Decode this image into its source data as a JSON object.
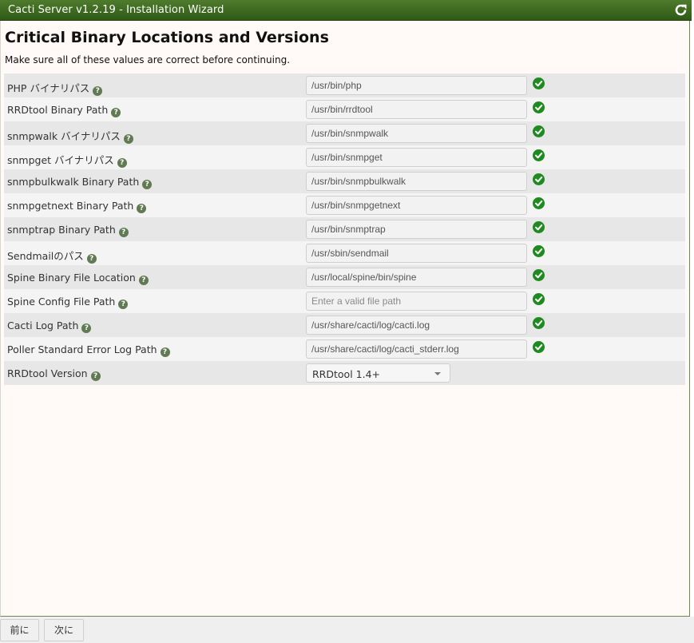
{
  "window": {
    "title": "Cacti Server v1.2.19 - Installation Wizard"
  },
  "header": {
    "title": "Critical Binary Locations and Versions",
    "subtitle": "Make sure all of these values are correct before continuing."
  },
  "rows": [
    {
      "label": "PHP バイナリパス",
      "value": "/usr/bin/php",
      "placeholder": "",
      "status": "ok"
    },
    {
      "label": "RRDtool Binary Path",
      "value": "/usr/bin/rrdtool",
      "placeholder": "",
      "status": "ok"
    },
    {
      "label": "snmpwalk バイナリパス",
      "value": "/usr/bin/snmpwalk",
      "placeholder": "",
      "status": "ok"
    },
    {
      "label": "snmpget バイナリパス",
      "value": "/usr/bin/snmpget",
      "placeholder": "",
      "status": "ok"
    },
    {
      "label": "snmpbulkwalk Binary Path",
      "value": "/usr/bin/snmpbulkwalk",
      "placeholder": "",
      "status": "ok"
    },
    {
      "label": "snmpgetnext Binary Path",
      "value": "/usr/bin/snmpgetnext",
      "placeholder": "",
      "status": "ok"
    },
    {
      "label": "snmptrap Binary Path",
      "value": "/usr/bin/snmptrap",
      "placeholder": "",
      "status": "ok"
    },
    {
      "label": "Sendmailのパス",
      "value": "/usr/sbin/sendmail",
      "placeholder": "",
      "status": "ok"
    },
    {
      "label": "Spine Binary File Location",
      "value": "/usr/local/spine/bin/spine",
      "placeholder": "",
      "status": "ok"
    },
    {
      "label": "Spine Config File Path",
      "value": "",
      "placeholder": "Enter a valid file path",
      "status": "ok"
    },
    {
      "label": "Cacti Log Path",
      "value": "/usr/share/cacti/log/cacti.log",
      "placeholder": "",
      "status": "ok"
    },
    {
      "label": "Poller Standard Error Log Path",
      "value": "/usr/share/cacti/log/cacti_stderr.log",
      "placeholder": "",
      "status": "ok"
    }
  ],
  "version_row": {
    "label": "RRDtool Version",
    "selected": "RRDtool 1.4+"
  },
  "footer": {
    "prev_label": "前に",
    "next_label": "次に"
  },
  "colors": {
    "titlebar": "#3d6b1f",
    "status_ok": "#1f8a1f",
    "help_icon": "#607a53"
  },
  "icons": {
    "refresh": "refresh-icon",
    "help": "help-icon",
    "status": "check-circle-icon"
  }
}
